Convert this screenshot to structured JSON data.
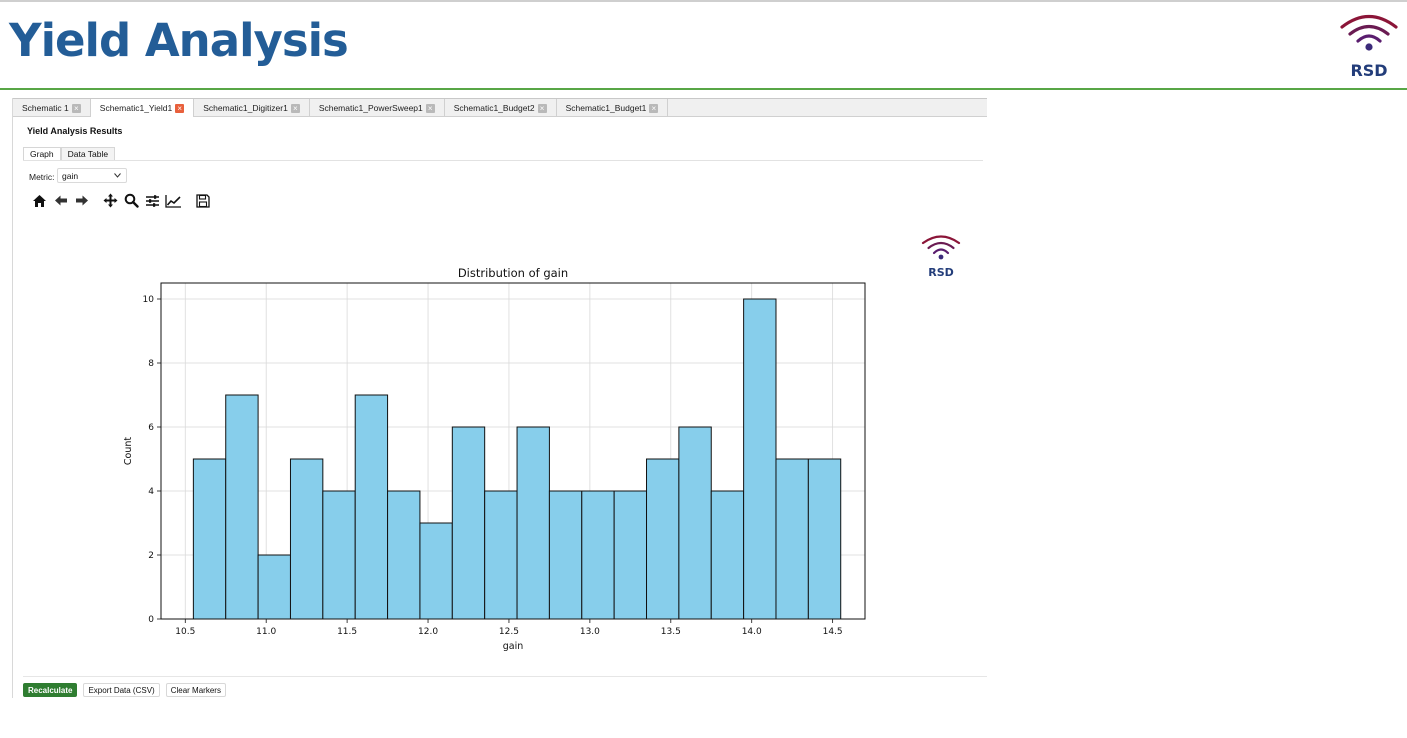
{
  "header": {
    "title": "Yield Analysis",
    "logo_text": "RSD"
  },
  "doc_tabs": [
    {
      "label": "Schematic 1",
      "active": false
    },
    {
      "label": "Schematic1_Yield1",
      "active": true
    },
    {
      "label": "Schematic1_Digitizer1",
      "active": false
    },
    {
      "label": "Schematic1_PowerSweep1",
      "active": false
    },
    {
      "label": "Schematic1_Budget2",
      "active": false
    },
    {
      "label": "Schematic1_Budget1",
      "active": false
    }
  ],
  "results": {
    "title": "Yield Analysis Results",
    "subtabs": [
      {
        "label": "Graph",
        "active": true
      },
      {
        "label": "Data Table",
        "active": false
      }
    ],
    "metric_label": "Metric:",
    "metric_value": "gain"
  },
  "toolbar_icons": [
    "home-icon",
    "back-icon",
    "forward-icon",
    "pan-icon",
    "zoom-icon",
    "configure-subplots-icon",
    "edit-axis-icon",
    "save-icon"
  ],
  "chart_logo_text": "RSD",
  "buttons": {
    "recalculate": "Recalculate",
    "export": "Export Data (CSV)",
    "clear": "Clear Markers"
  },
  "colors": {
    "title": "#235d97",
    "accent_green": "#58a646",
    "bar_fill": "#87ceeb",
    "primary_button": "#2f7d31",
    "logo_arc_outer": "#8b1538",
    "logo_arc_inner": "#5a1d6e",
    "logo_text": "#233d7a"
  },
  "chart_data": {
    "type": "bar",
    "title": "Distribution of gain",
    "xlabel": "gain",
    "ylabel": "Count",
    "xlim": [
      10.35,
      14.7
    ],
    "ylim": [
      0,
      10.5
    ],
    "bin_edges": [
      10.55,
      10.75,
      10.95,
      11.15,
      11.35,
      11.55,
      11.75,
      11.95,
      12.15,
      12.35,
      12.55,
      12.75,
      12.95,
      13.15,
      13.35,
      13.55,
      13.75,
      13.95,
      14.15,
      14.35,
      14.55
    ],
    "values": [
      5,
      7,
      2,
      5,
      4,
      7,
      4,
      3,
      6,
      4,
      6,
      4,
      4,
      4,
      5,
      6,
      4,
      10,
      5,
      5
    ],
    "xticks": [
      "10.5",
      "11.0",
      "11.5",
      "12.0",
      "12.5",
      "13.0",
      "13.5",
      "14.0",
      "14.5"
    ],
    "yticks": [
      "0",
      "2",
      "4",
      "6",
      "8",
      "10"
    ],
    "grid": true
  }
}
